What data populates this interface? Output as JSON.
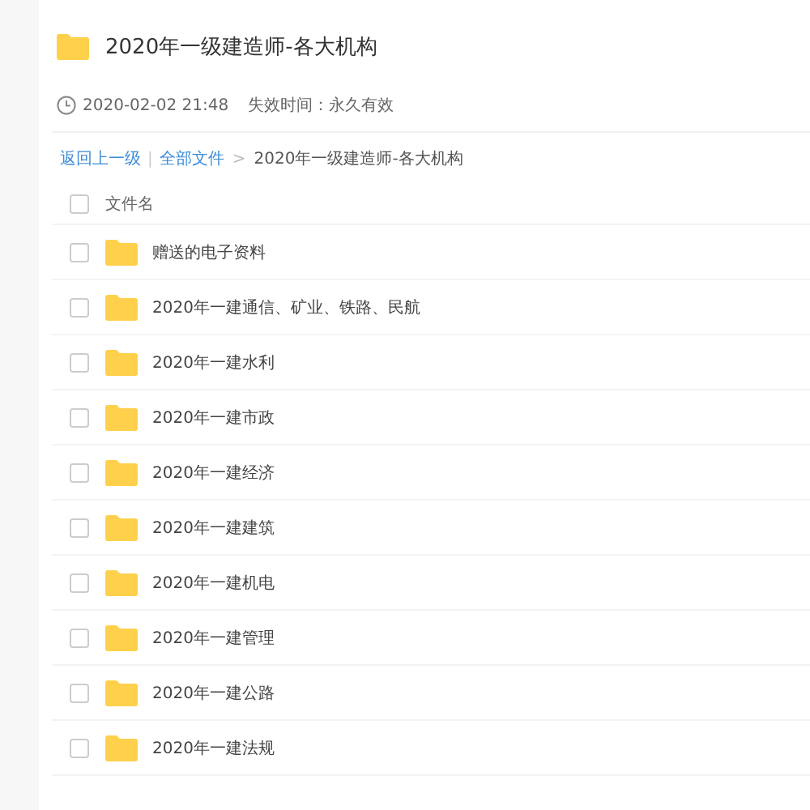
{
  "title": "2020年一级建造师-各大机构",
  "meta": {
    "date": "2020-02-02 21:48",
    "expiry": "失效时间：永久有效"
  },
  "breadcrumb": {
    "back": "返回上一级",
    "separator": "|",
    "all": "全部文件",
    "arrow": ">",
    "current": "2020年一级建造师-各大机构"
  },
  "header": {
    "label": "文件名",
    "checked": false
  },
  "files": [
    {
      "name": "赠送的电子资料",
      "checked": false
    },
    {
      "name": "2020年一建通信、矿业、铁路、民航",
      "checked": false
    },
    {
      "name": "2020年一建水利",
      "checked": false
    },
    {
      "name": "2020年一建市政",
      "checked": false
    },
    {
      "name": "2020年一建经济",
      "checked": false
    },
    {
      "name": "2020年一建建筑",
      "checked": false
    },
    {
      "name": "2020年一建机电",
      "checked": false
    },
    {
      "name": "2020年一建管理",
      "checked": false
    },
    {
      "name": "2020年一建公路",
      "checked": false
    },
    {
      "name": "2020年一建法规",
      "checked": false
    }
  ]
}
